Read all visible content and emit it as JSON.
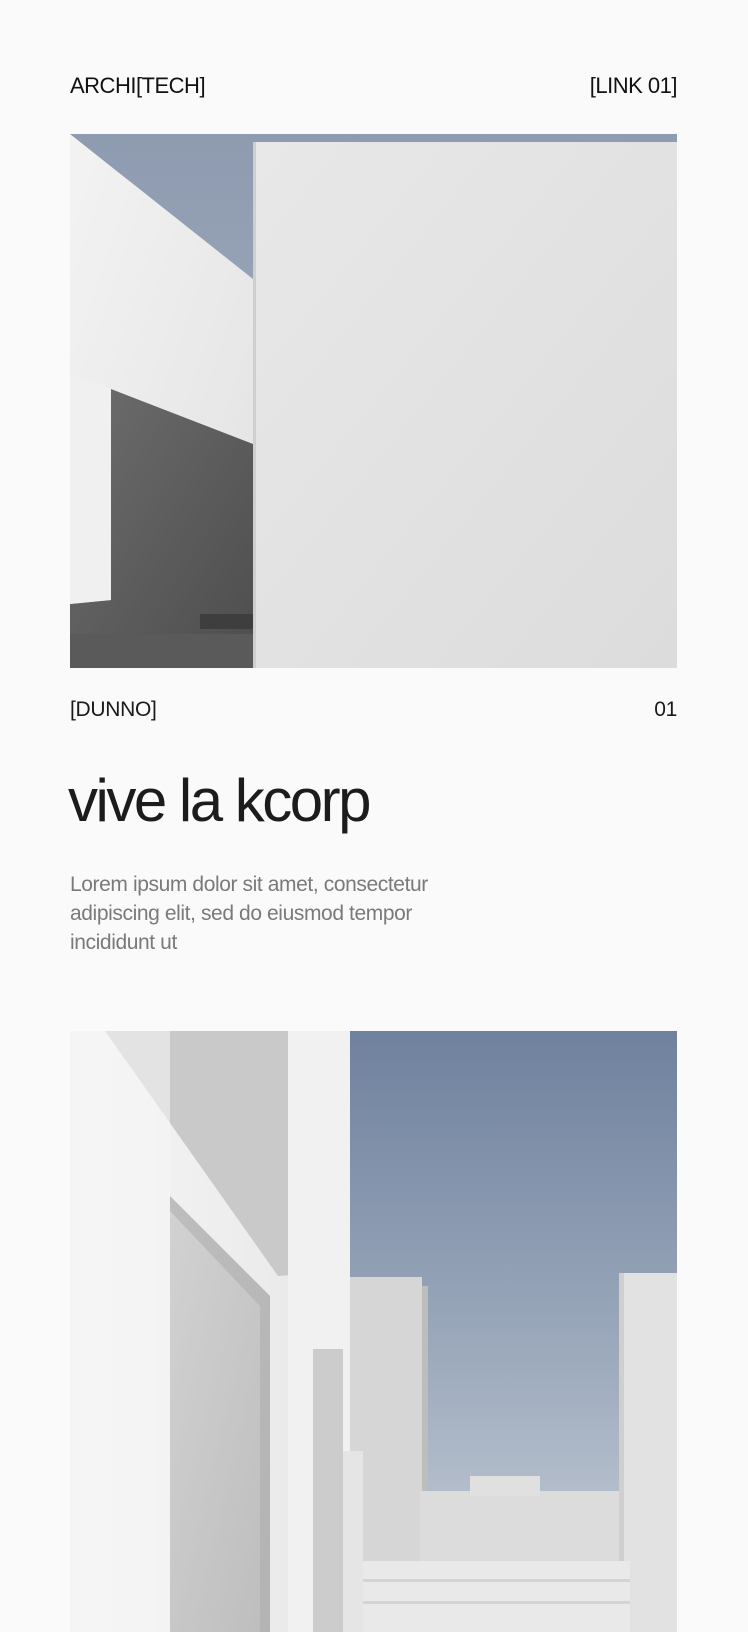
{
  "header": {
    "logo": "ARCHI[TECH]",
    "link": "[LINK 01]"
  },
  "project": {
    "label": "[DUNNO]",
    "number": "01",
    "title": "vive la kcorp",
    "description": "Lorem ipsum dolor sit amet, consectetur adipiscing elit, sed do eiusmod tempor incididunt ut"
  },
  "images": {
    "hero": "architecture-photo",
    "second": "architecture-photo"
  },
  "colors": {
    "background": "#fafafa",
    "text": "#141414",
    "muted_text": "#7a7a7a",
    "sky": "#7c8ba3"
  }
}
